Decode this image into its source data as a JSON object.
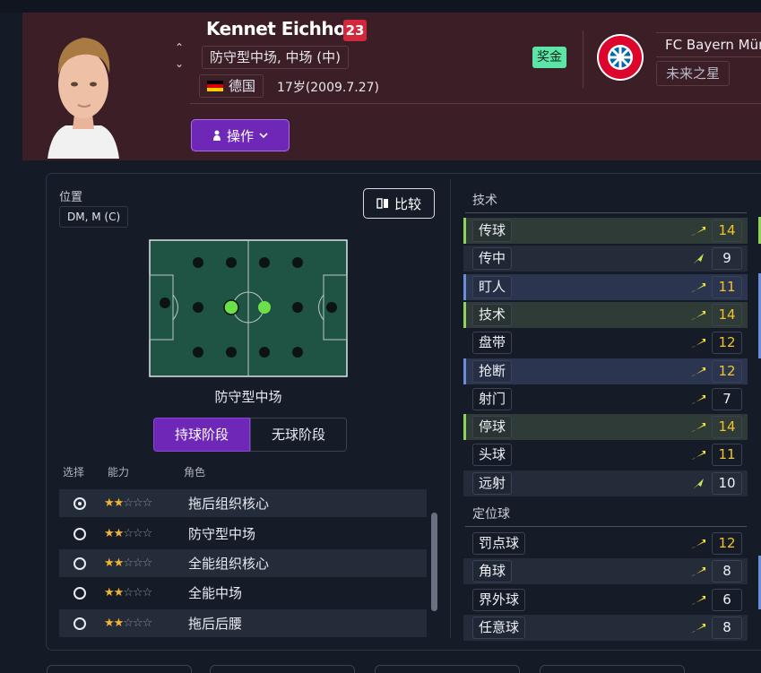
{
  "header": {
    "breadcrumb": "",
    "player_name": "Kennet Eichhorn",
    "shirt_number": "23",
    "positions": "防守型中场, 中场 (中)",
    "nationality": "德国",
    "age_birth": "17岁(2009.7.27)",
    "action_label": "操作",
    "bonus_label": "奖金",
    "club_name": "FC Bayern Münc",
    "club_sub": "未来之星"
  },
  "left": {
    "position_label": "位置",
    "position_code": "DM, M (C)",
    "compare_label": "比较",
    "role_name": "防守型中场",
    "tabs": [
      "持球阶段",
      "无球阶段"
    ],
    "col_headers": {
      "select": "选择",
      "ability": "能力",
      "role": "角色"
    },
    "roles": [
      {
        "name": "拖后组织核心",
        "stars": 2,
        "selected": true
      },
      {
        "name": "防守型中场",
        "stars": 2,
        "selected": false
      },
      {
        "name": "全能组织核心",
        "stars": 2,
        "selected": false
      },
      {
        "name": "全能中场",
        "stars": 2,
        "selected": false
      },
      {
        "name": "拖后后腰",
        "stars": 2,
        "selected": false
      }
    ]
  },
  "right": {
    "technical_header": "技术",
    "setpiece_header": "定位球",
    "technical": [
      {
        "name": "传球",
        "value": "14",
        "hl": "g",
        "trend": "up"
      },
      {
        "name": "传中",
        "value": "9",
        "hl": "",
        "trend": "strong-up"
      },
      {
        "name": "盯人",
        "value": "11",
        "hl": "b",
        "trend": "up"
      },
      {
        "name": "技术",
        "value": "14",
        "hl": "g",
        "trend": "up"
      },
      {
        "name": "盘带",
        "value": "12",
        "hl": "",
        "trend": "up"
      },
      {
        "name": "抢断",
        "value": "12",
        "hl": "b",
        "trend": "up"
      },
      {
        "name": "射门",
        "value": "7",
        "hl": "",
        "trend": "up"
      },
      {
        "name": "停球",
        "value": "14",
        "hl": "g",
        "trend": "up"
      },
      {
        "name": "头球",
        "value": "11",
        "hl": "",
        "trend": "up"
      },
      {
        "name": "远射",
        "value": "10",
        "hl": "",
        "trend": "strong-up"
      }
    ],
    "setpieces": [
      {
        "name": "罚点球",
        "value": "12",
        "trend": "up"
      },
      {
        "name": "角球",
        "value": "8",
        "trend": "up"
      },
      {
        "name": "界外球",
        "value": "6",
        "trend": "up"
      },
      {
        "name": "任意球",
        "value": "8",
        "trend": "up"
      }
    ]
  },
  "colors": {
    "accent": "#6f27b8",
    "header_bg": "#3c1e27",
    "highlight_value": "#f4c12e",
    "green_dot": "#6be04a",
    "pitch": "#1f5444"
  }
}
